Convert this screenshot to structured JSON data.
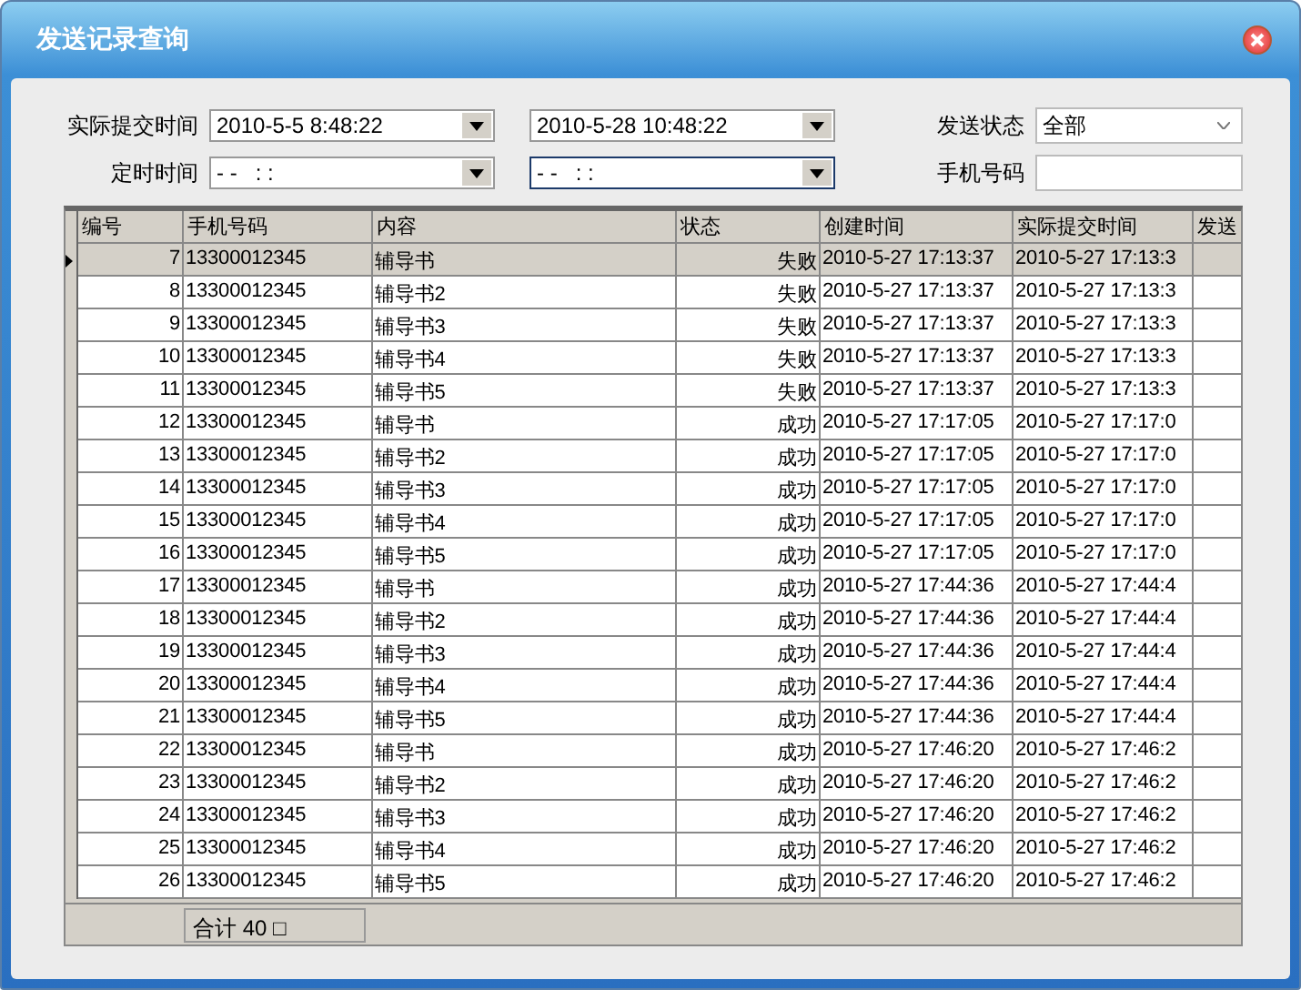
{
  "window": {
    "title": "发送记录查询"
  },
  "filters": {
    "submit_time": {
      "label": "实际提交时间",
      "from": {
        "value": "2010-5-5 8:48:22",
        "focused": false
      },
      "to": {
        "value": "2010-5-28 10:48:22",
        "focused": false
      }
    },
    "scheduled_time": {
      "label": "定时时间",
      "from": {
        "value": "- -   : :",
        "focused": false
      },
      "to": {
        "value": "- -   : :",
        "focused": true
      }
    },
    "status": {
      "label": "发送状态",
      "value": "全部"
    },
    "phone": {
      "label": "手机号码"
    }
  },
  "table": {
    "columns": [
      "编号",
      "手机号码",
      "内容",
      "状态",
      "创建时间",
      "实际提交时间",
      "发送"
    ],
    "rows": [
      {
        "cells": [
          "7",
          "13300012345",
          "辅导书",
          "失败",
          "2010-5-27 17:13:37",
          "2010-5-27 17:13:3",
          ""
        ],
        "selected": true
      },
      {
        "cells": [
          "8",
          "13300012345",
          "辅导书2",
          "失败",
          "2010-5-27 17:13:37",
          "2010-5-27 17:13:3",
          ""
        ],
        "selected": false
      },
      {
        "cells": [
          "9",
          "13300012345",
          "辅导书3",
          "失败",
          "2010-5-27 17:13:37",
          "2010-5-27 17:13:3",
          ""
        ],
        "selected": false
      },
      {
        "cells": [
          "10",
          "13300012345",
          "辅导书4",
          "失败",
          "2010-5-27 17:13:37",
          "2010-5-27 17:13:3",
          ""
        ],
        "selected": false
      },
      {
        "cells": [
          "11",
          "13300012345",
          "辅导书5",
          "失败",
          "2010-5-27 17:13:37",
          "2010-5-27 17:13:3",
          ""
        ],
        "selected": false
      },
      {
        "cells": [
          "12",
          "13300012345",
          "辅导书",
          "成功",
          "2010-5-27 17:17:05",
          "2010-5-27 17:17:0",
          ""
        ],
        "selected": false
      },
      {
        "cells": [
          "13",
          "13300012345",
          "辅导书2",
          "成功",
          "2010-5-27 17:17:05",
          "2010-5-27 17:17:0",
          ""
        ],
        "selected": false
      },
      {
        "cells": [
          "14",
          "13300012345",
          "辅导书3",
          "成功",
          "2010-5-27 17:17:05",
          "2010-5-27 17:17:0",
          ""
        ],
        "selected": false
      },
      {
        "cells": [
          "15",
          "13300012345",
          "辅导书4",
          "成功",
          "2010-5-27 17:17:05",
          "2010-5-27 17:17:0",
          ""
        ],
        "selected": false
      },
      {
        "cells": [
          "16",
          "13300012345",
          "辅导书5",
          "成功",
          "2010-5-27 17:17:05",
          "2010-5-27 17:17:0",
          ""
        ],
        "selected": false
      },
      {
        "cells": [
          "17",
          "13300012345",
          "辅导书",
          "成功",
          "2010-5-27 17:44:36",
          "2010-5-27 17:44:4",
          ""
        ],
        "selected": false
      },
      {
        "cells": [
          "18",
          "13300012345",
          "辅导书2",
          "成功",
          "2010-5-27 17:44:36",
          "2010-5-27 17:44:4",
          ""
        ],
        "selected": false
      },
      {
        "cells": [
          "19",
          "13300012345",
          "辅导书3",
          "成功",
          "2010-5-27 17:44:36",
          "2010-5-27 17:44:4",
          ""
        ],
        "selected": false
      },
      {
        "cells": [
          "20",
          "13300012345",
          "辅导书4",
          "成功",
          "2010-5-27 17:44:36",
          "2010-5-27 17:44:4",
          ""
        ],
        "selected": false
      },
      {
        "cells": [
          "21",
          "13300012345",
          "辅导书5",
          "成功",
          "2010-5-27 17:44:36",
          "2010-5-27 17:44:4",
          ""
        ],
        "selected": false
      },
      {
        "cells": [
          "22",
          "13300012345",
          "辅导书",
          "成功",
          "2010-5-27 17:46:20",
          "2010-5-27 17:46:2",
          ""
        ],
        "selected": false
      },
      {
        "cells": [
          "23",
          "13300012345",
          "辅导书2",
          "成功",
          "2010-5-27 17:46:20",
          "2010-5-27 17:46:2",
          ""
        ],
        "selected": false
      },
      {
        "cells": [
          "24",
          "13300012345",
          "辅导书3",
          "成功",
          "2010-5-27 17:46:20",
          "2010-5-27 17:46:2",
          ""
        ],
        "selected": false
      },
      {
        "cells": [
          "25",
          "13300012345",
          "辅导书4",
          "成功",
          "2010-5-27 17:46:20",
          "2010-5-27 17:46:2",
          ""
        ],
        "selected": false
      },
      {
        "cells": [
          "26",
          "13300012345",
          "辅导书5",
          "成功",
          "2010-5-27 17:46:20",
          "2010-5-27 17:46:2",
          ""
        ],
        "selected": false
      }
    ],
    "footer": {
      "total": "合计 40 □"
    }
  }
}
